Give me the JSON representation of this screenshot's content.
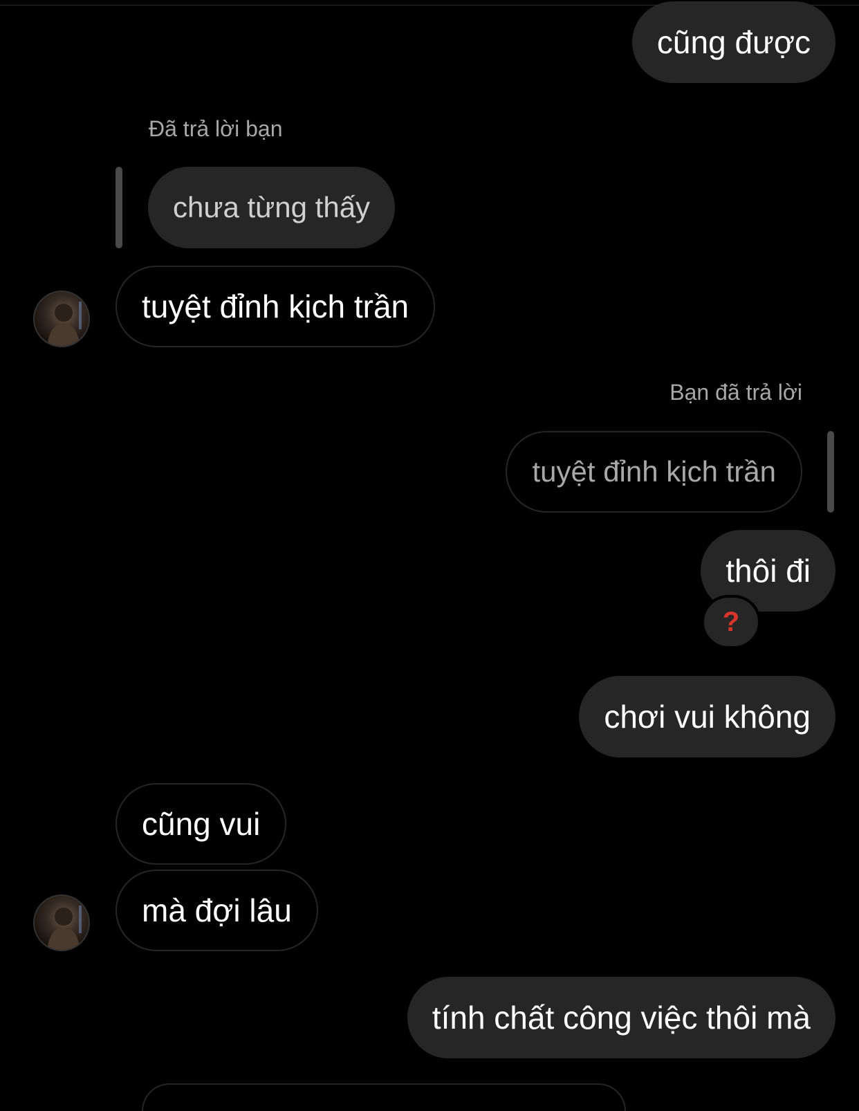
{
  "theme": {
    "background": "#000000",
    "sent_bubble": "#262626",
    "received_border": "#262626",
    "caption_color": "#a8a8a8",
    "reaction_color": "#d8342a"
  },
  "messages": [
    {
      "id": "m1",
      "side": "sent",
      "text": "cũng được"
    },
    {
      "id": "m2",
      "side": "received",
      "reply_caption": "Đã trả lời bạn",
      "quoted_text": "chưa từng thấy",
      "text": "tuyệt đỉnh kịch trần"
    },
    {
      "id": "m3",
      "side": "sent",
      "reply_caption": "Bạn đã trả lời",
      "quoted_text": "tuyệt đỉnh kịch trần",
      "text": "thôi đi",
      "reaction": "?"
    },
    {
      "id": "m4",
      "side": "sent",
      "text": "chơi vui không"
    },
    {
      "id": "m5",
      "side": "received",
      "text": "cũng vui"
    },
    {
      "id": "m6",
      "side": "received",
      "text": "mà đợi lâu"
    },
    {
      "id": "m7",
      "side": "sent",
      "text": "tính chất công việc thôi mà"
    }
  ],
  "icons": {
    "avatar": "user-avatar-photo",
    "reaction": "red-question-mark-icon"
  }
}
